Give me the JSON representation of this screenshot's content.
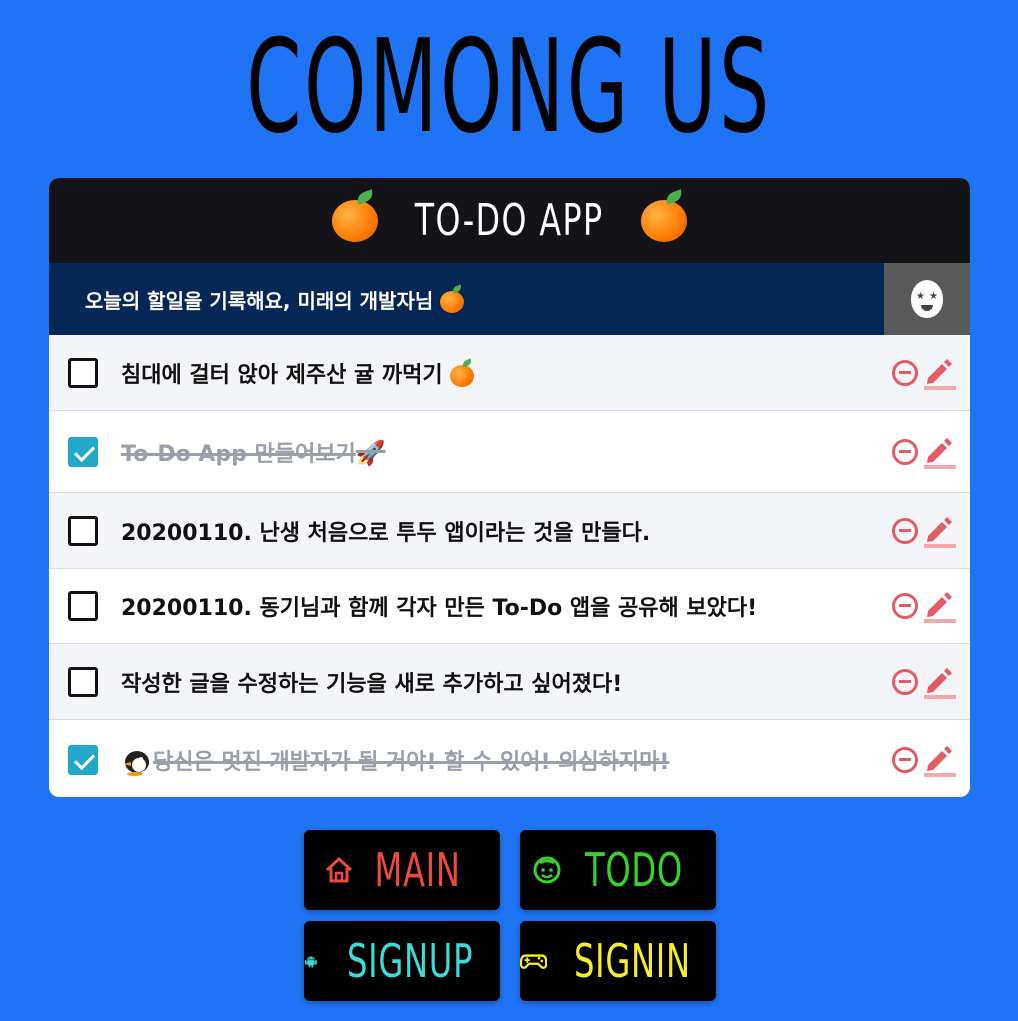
{
  "site_title": "COMONG US",
  "card": {
    "title": "TO-DO APP",
    "subtitle": "오늘의 할일을 기록해요, 미래의 개발자님"
  },
  "todos": [
    {
      "text": "침대에 걸터 앉아 제주산 귤 까먹기",
      "done": false,
      "emoji": "orange"
    },
    {
      "text": "To-Do App 만들어보기",
      "done": true,
      "emoji": "🚀"
    },
    {
      "text": "20200110. 난생 처음으로 투두 앱이라는 것을 만들다.",
      "done": false
    },
    {
      "text": "20200110. 동기님과 함께 각자 만든 To-Do 앱을 공유해 보았다!",
      "done": false
    },
    {
      "text": "작성한 글을 수정하는 기능을 새로 추가하고 싶어졌다!",
      "done": false
    },
    {
      "text": "당신은 멋진 개발자가 될 거야! 할 수 있어! 의심하지마!",
      "done": true,
      "emoji": "penguin"
    }
  ],
  "nav": {
    "main": "MAIN",
    "todo": "TODO",
    "signup": "SIGNUP",
    "signin": "SIGNIN"
  },
  "colors": {
    "background": "#1f74f5",
    "main": "#ec4a3f",
    "todo": "#37d22b",
    "signup": "#3ddad6",
    "signin": "#f4ef2a",
    "remove": "#e35b67",
    "check": "#22a9c9"
  }
}
